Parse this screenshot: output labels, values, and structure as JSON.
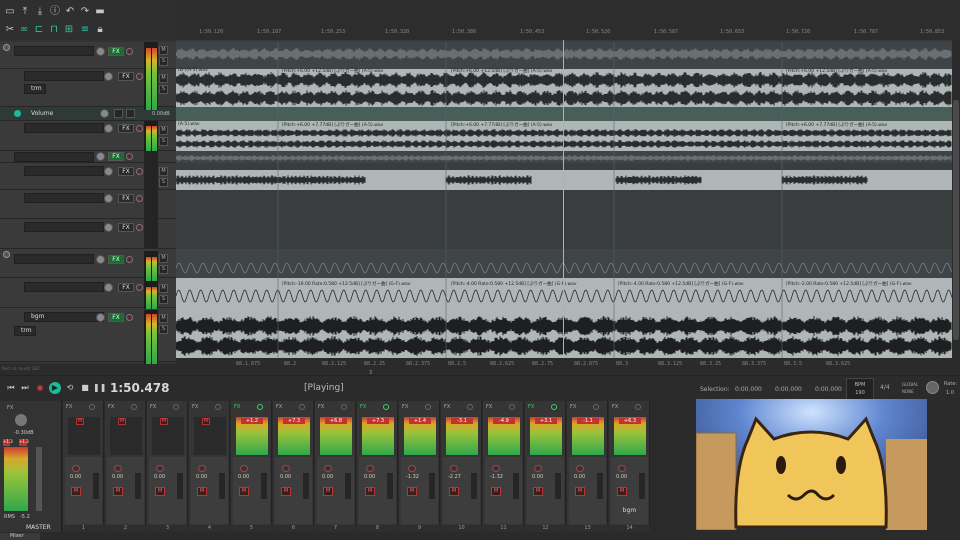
{
  "toolbar": {
    "icons_row1": [
      "new-project-icon",
      "save-icon",
      "render-icon",
      "info-icon",
      "undo-icon",
      "redo-icon",
      "toggle-icon",
      "grid-icon",
      "more-icon"
    ],
    "icons_row2": [
      "ripple-icon",
      "loop-icon",
      "snap-icon",
      "grid-snap-icon",
      "envelope-icon",
      "lock-icon"
    ]
  },
  "ruler": {
    "labels": [
      "1:50.120",
      "1:50.187",
      "1:50.253",
      "1:50.320",
      "1:50.386",
      "1:50.453",
      "1:50.520",
      "1:50.587",
      "1:50.653",
      "1:50.720",
      "1:50.787",
      "1:50.853"
    ]
  },
  "tracks": [
    {
      "name": "",
      "fx": "FX",
      "fx_on": true
    },
    {
      "name": "trm",
      "fx": "FX",
      "fx_on": false
    },
    {
      "name": "Volume",
      "value": "0.00dB",
      "fx": "",
      "fx_on": false
    },
    {
      "name": "",
      "fx": "FX",
      "fx_on": false
    },
    {
      "name": "",
      "fx": "FX",
      "fx_on": true
    },
    {
      "name": "",
      "fx": "FX",
      "fx_on": false
    },
    {
      "name": "",
      "fx": "FX",
      "fx_on": false
    },
    {
      "name": "",
      "fx": "FX",
      "fx_on": false
    },
    {
      "name": "",
      "fx": "FX",
      "fx_on": true
    },
    {
      "name": "",
      "fx": "FX",
      "fx_on": false
    },
    {
      "name": "bgm",
      "fx": "FX",
      "fx_on": true
    },
    {
      "name": "trm",
      "fx": "",
      "fx_on": false
    }
  ],
  "items": {
    "pitch_label_a": "[Pitch:+6.00 +12.5dB] [ぷりガー曲] (A-5).wav",
    "pitch_label_b": "[Pitch:+6.00 +7.77dB] [ぷりガー曲] (A-5).wav",
    "pitch_label_c": "[Pitch:-16.00 Rate:0.580 +12.5dB] [ぷりガー曲] (G-F).wav",
    "pitch_label_d": "[Pitch:-4.00 Rate:0.580 +12.5dB] [ぷりガー曲] (G-F).wav",
    "pitch_label_e": "[Pitch:-2.00 Rate:0.580 +12.5dB] [ぷりガー曲] (G-F).wav",
    "short_label_a": "(B-)(A-5).wav",
    "short_label_b": "(A-5).wav"
  },
  "bottom_ruler": {
    "labels": [
      "88.1.875",
      "88.2",
      "88.2.125",
      "88.2.25",
      "88.2.375",
      "88.2.5",
      "88.2.625",
      "88.2.75",
      "88.2.875",
      "88.3",
      "88.3.125",
      "88.3.25",
      "88.3.375",
      "88.3.5",
      "88.3.625"
    ],
    "hint": "Rect x1 (ount) 182"
  },
  "transport": {
    "time": "1:50.478",
    "status": "[Playing]",
    "selection_label": "Selection:",
    "sel_start": "0:00.000",
    "sel_end": "0:00.000",
    "sel_len": "0:00.000",
    "bpm_label": "BPM",
    "bpm": "190",
    "timesig": "4/4",
    "global_label": "GLOBAL",
    "none_label": "NONE",
    "rate_label": "Rate:",
    "rate": "1.0"
  },
  "mixer": {
    "master": {
      "label": "MASTER",
      "vol": "-0.30dB",
      "peak_l": "+1.3",
      "peak_r": "+1.3",
      "rms_label": "RMS",
      "rms": "-5.2"
    },
    "strips": [
      {
        "num": "1",
        "fx_on": false,
        "peak": "M",
        "muted": true,
        "vol": "0.00",
        "name": ""
      },
      {
        "num": "2",
        "fx_on": false,
        "peak": "M",
        "muted": true,
        "vol": "0.00",
        "name": ""
      },
      {
        "num": "3",
        "fx_on": false,
        "peak": "M",
        "muted": true,
        "vol": "0.00",
        "name": ""
      },
      {
        "num": "4",
        "fx_on": false,
        "peak": "M",
        "muted": true,
        "vol": "0.00",
        "name": ""
      },
      {
        "num": "5",
        "fx_on": true,
        "peak": "+1.2",
        "muted": false,
        "vol": "0.00",
        "name": ""
      },
      {
        "num": "6",
        "fx_on": false,
        "peak": "+7.3",
        "muted": false,
        "vol": "0.00",
        "name": ""
      },
      {
        "num": "7",
        "fx_on": false,
        "peak": "+6.8",
        "muted": false,
        "vol": "0.00",
        "name": ""
      },
      {
        "num": "8",
        "fx_on": true,
        "peak": "+7.3",
        "muted": false,
        "vol": "0.00",
        "name": ""
      },
      {
        "num": "9",
        "fx_on": false,
        "peak": "+1.4",
        "muted": false,
        "vol": "-1.32",
        "name": ""
      },
      {
        "num": "10",
        "fx_on": false,
        "peak": "-3.1",
        "muted": false,
        "vol": "-2.27",
        "name": ""
      },
      {
        "num": "11",
        "fx_on": false,
        "peak": "-4.9",
        "muted": false,
        "vol": "-1.32",
        "name": ""
      },
      {
        "num": "12",
        "fx_on": true,
        "peak": "+3.1",
        "muted": false,
        "vol": "0.00",
        "name": ""
      },
      {
        "num": "13",
        "fx_on": false,
        "peak": "-1.1",
        "muted": false,
        "vol": "0.00",
        "name": ""
      },
      {
        "num": "14",
        "fx_on": false,
        "peak": "+6.3",
        "muted": false,
        "vol": "0.00",
        "name": "bgm"
      }
    ],
    "tab_label": "Mixer"
  },
  "colors": {
    "accent_teal": "#1fb89a",
    "cursor": "#d7b43b",
    "fx_green": "#1e6b32",
    "mute_red": "#c0342f"
  }
}
